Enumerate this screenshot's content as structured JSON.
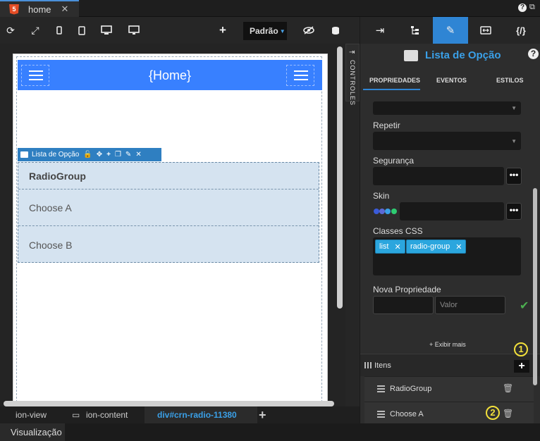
{
  "top": {
    "tab_title": "home",
    "tab_close": "✕",
    "html5_badge": "5",
    "help": "?"
  },
  "toolbar": {
    "device_label": "Padrão"
  },
  "canvas": {
    "header_title": "{Home}",
    "control_toolbar_label": "Lista de Opção",
    "radio_group": {
      "title": "RadioGroup",
      "options": [
        "Choose A",
        "Choose B"
      ]
    },
    "side_tab": "CONTROLES"
  },
  "breadcrumb": {
    "items": [
      "ion-view",
      "ion-content"
    ],
    "active": "div#crn-radio-11380",
    "add": "+"
  },
  "bottom": {
    "tab": "Visualização"
  },
  "panel": {
    "title": "Lista de Opção",
    "help": "?",
    "subtabs": [
      "PROPRIEDADES",
      "EVENTOS",
      "ESTILOS"
    ],
    "fields": {
      "repetir": "Repetir",
      "seguranca": "Segurança",
      "skin": "Skin",
      "classes_css": "Classes CSS",
      "nova_propriedade": "Nova Propriedade"
    },
    "css_classes": [
      "list",
      "radio-group"
    ],
    "chip_close": "✕",
    "dots": "•••",
    "valor_placeholder": "Valor",
    "exibir_mais": "+ Exibir mais",
    "items_label": "Itens",
    "items_add": "+",
    "items": [
      "RadioGroup",
      "Choose A"
    ],
    "badges": [
      "1",
      "2"
    ],
    "skin_colors": [
      "#3a5bd9",
      "#5b6ad6",
      "#3aa0e8",
      "#2ecc71"
    ]
  }
}
